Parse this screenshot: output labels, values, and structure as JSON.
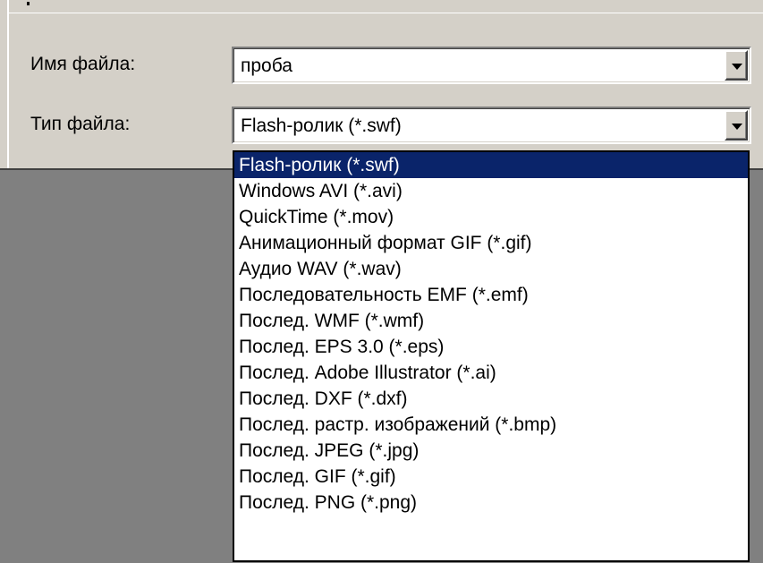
{
  "form": {
    "filename_label": "Имя файла:",
    "filename_value": "проба",
    "filetype_label": "Тип файла:",
    "filetype_value": "Flash-ролик (*.swf)"
  },
  "dropdown": {
    "selected_index": 0,
    "options": [
      "Flash-ролик (*.swf)",
      "Windows AVI (*.avi)",
      "QuickTime (*.mov)",
      "Анимационный формат GIF (*.gif)",
      "Аудио WAV (*.wav)",
      "Последовательность EMF (*.emf)",
      "Послед. WMF (*.wmf)",
      "Послед. EPS 3.0 (*.eps)",
      "Послед. Adobe Illustrator (*.ai)",
      "Послед. DXF (*.dxf)",
      "Послед. растр. изображений (*.bmp)",
      "Послед. JPEG (*.jpg)",
      "Послед. GIF (*.gif)",
      "Послед. PNG (*.png)"
    ]
  },
  "icons": {
    "dropdown_arrow": "chevron-down-icon"
  },
  "colors": {
    "dialog_bg": "#d4d0c8",
    "selection_bg": "#0a246a",
    "selection_fg": "#ffffff",
    "backdrop": "#808080"
  }
}
